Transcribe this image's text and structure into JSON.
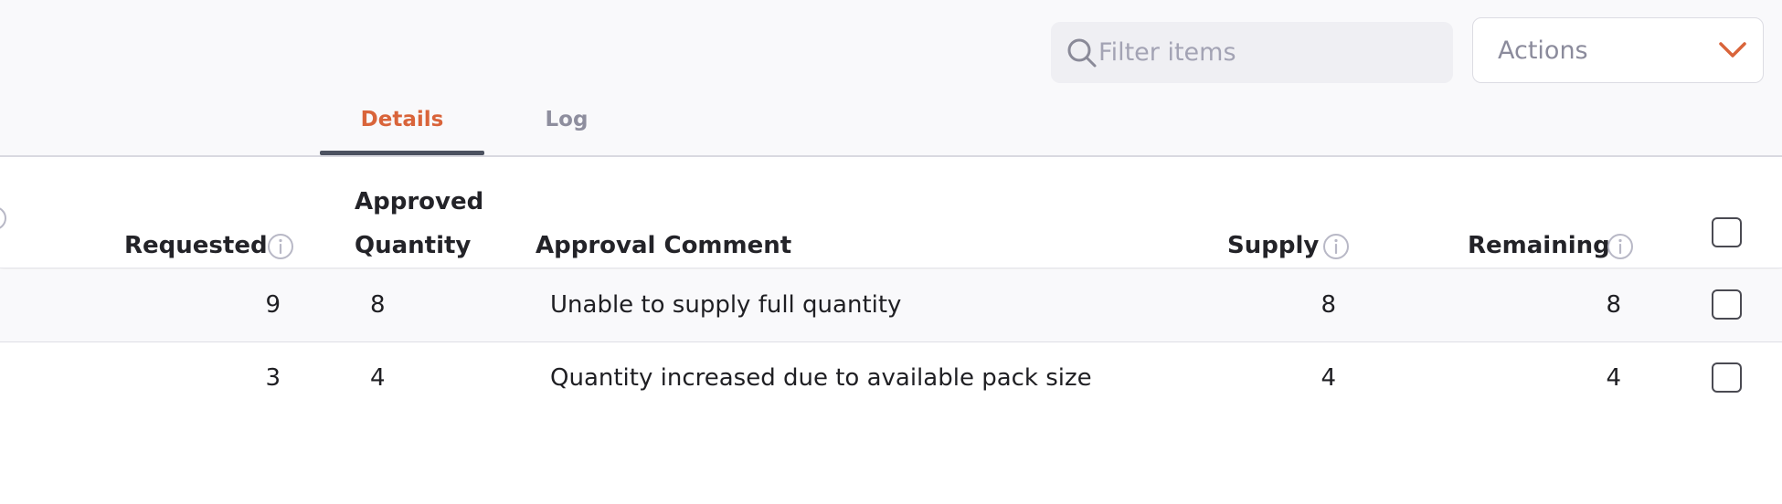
{
  "toolbar": {
    "search_placeholder": "Filter items",
    "actions_label": "Actions"
  },
  "tabs": [
    {
      "label": "Details",
      "active": true
    },
    {
      "label": "Log",
      "active": false
    }
  ],
  "table": {
    "headers": {
      "requested": "Requested",
      "approved_line1": "Approved",
      "approved_line2": "Quantity",
      "approval_comment": "Approval Comment",
      "supply": "Supply",
      "remaining": "Remaining"
    },
    "rows": [
      {
        "requested": "9",
        "approved": "8",
        "comment": "Unable to supply full quantity",
        "supply": "8",
        "remaining": "8",
        "checked": false
      },
      {
        "requested": "3",
        "approved": "4",
        "comment": "Quantity increased due to available pack size",
        "supply": "4",
        "remaining": "4",
        "checked": false
      }
    ]
  },
  "colors": {
    "accent": "#d9643a",
    "tab_underline": "#4c5260",
    "header_bg": "#f9f9fb",
    "muted_text": "#8e8e9e"
  },
  "icons": {
    "search": "search-icon",
    "dropdown": "chevron-down-icon",
    "info": "info-icon"
  }
}
